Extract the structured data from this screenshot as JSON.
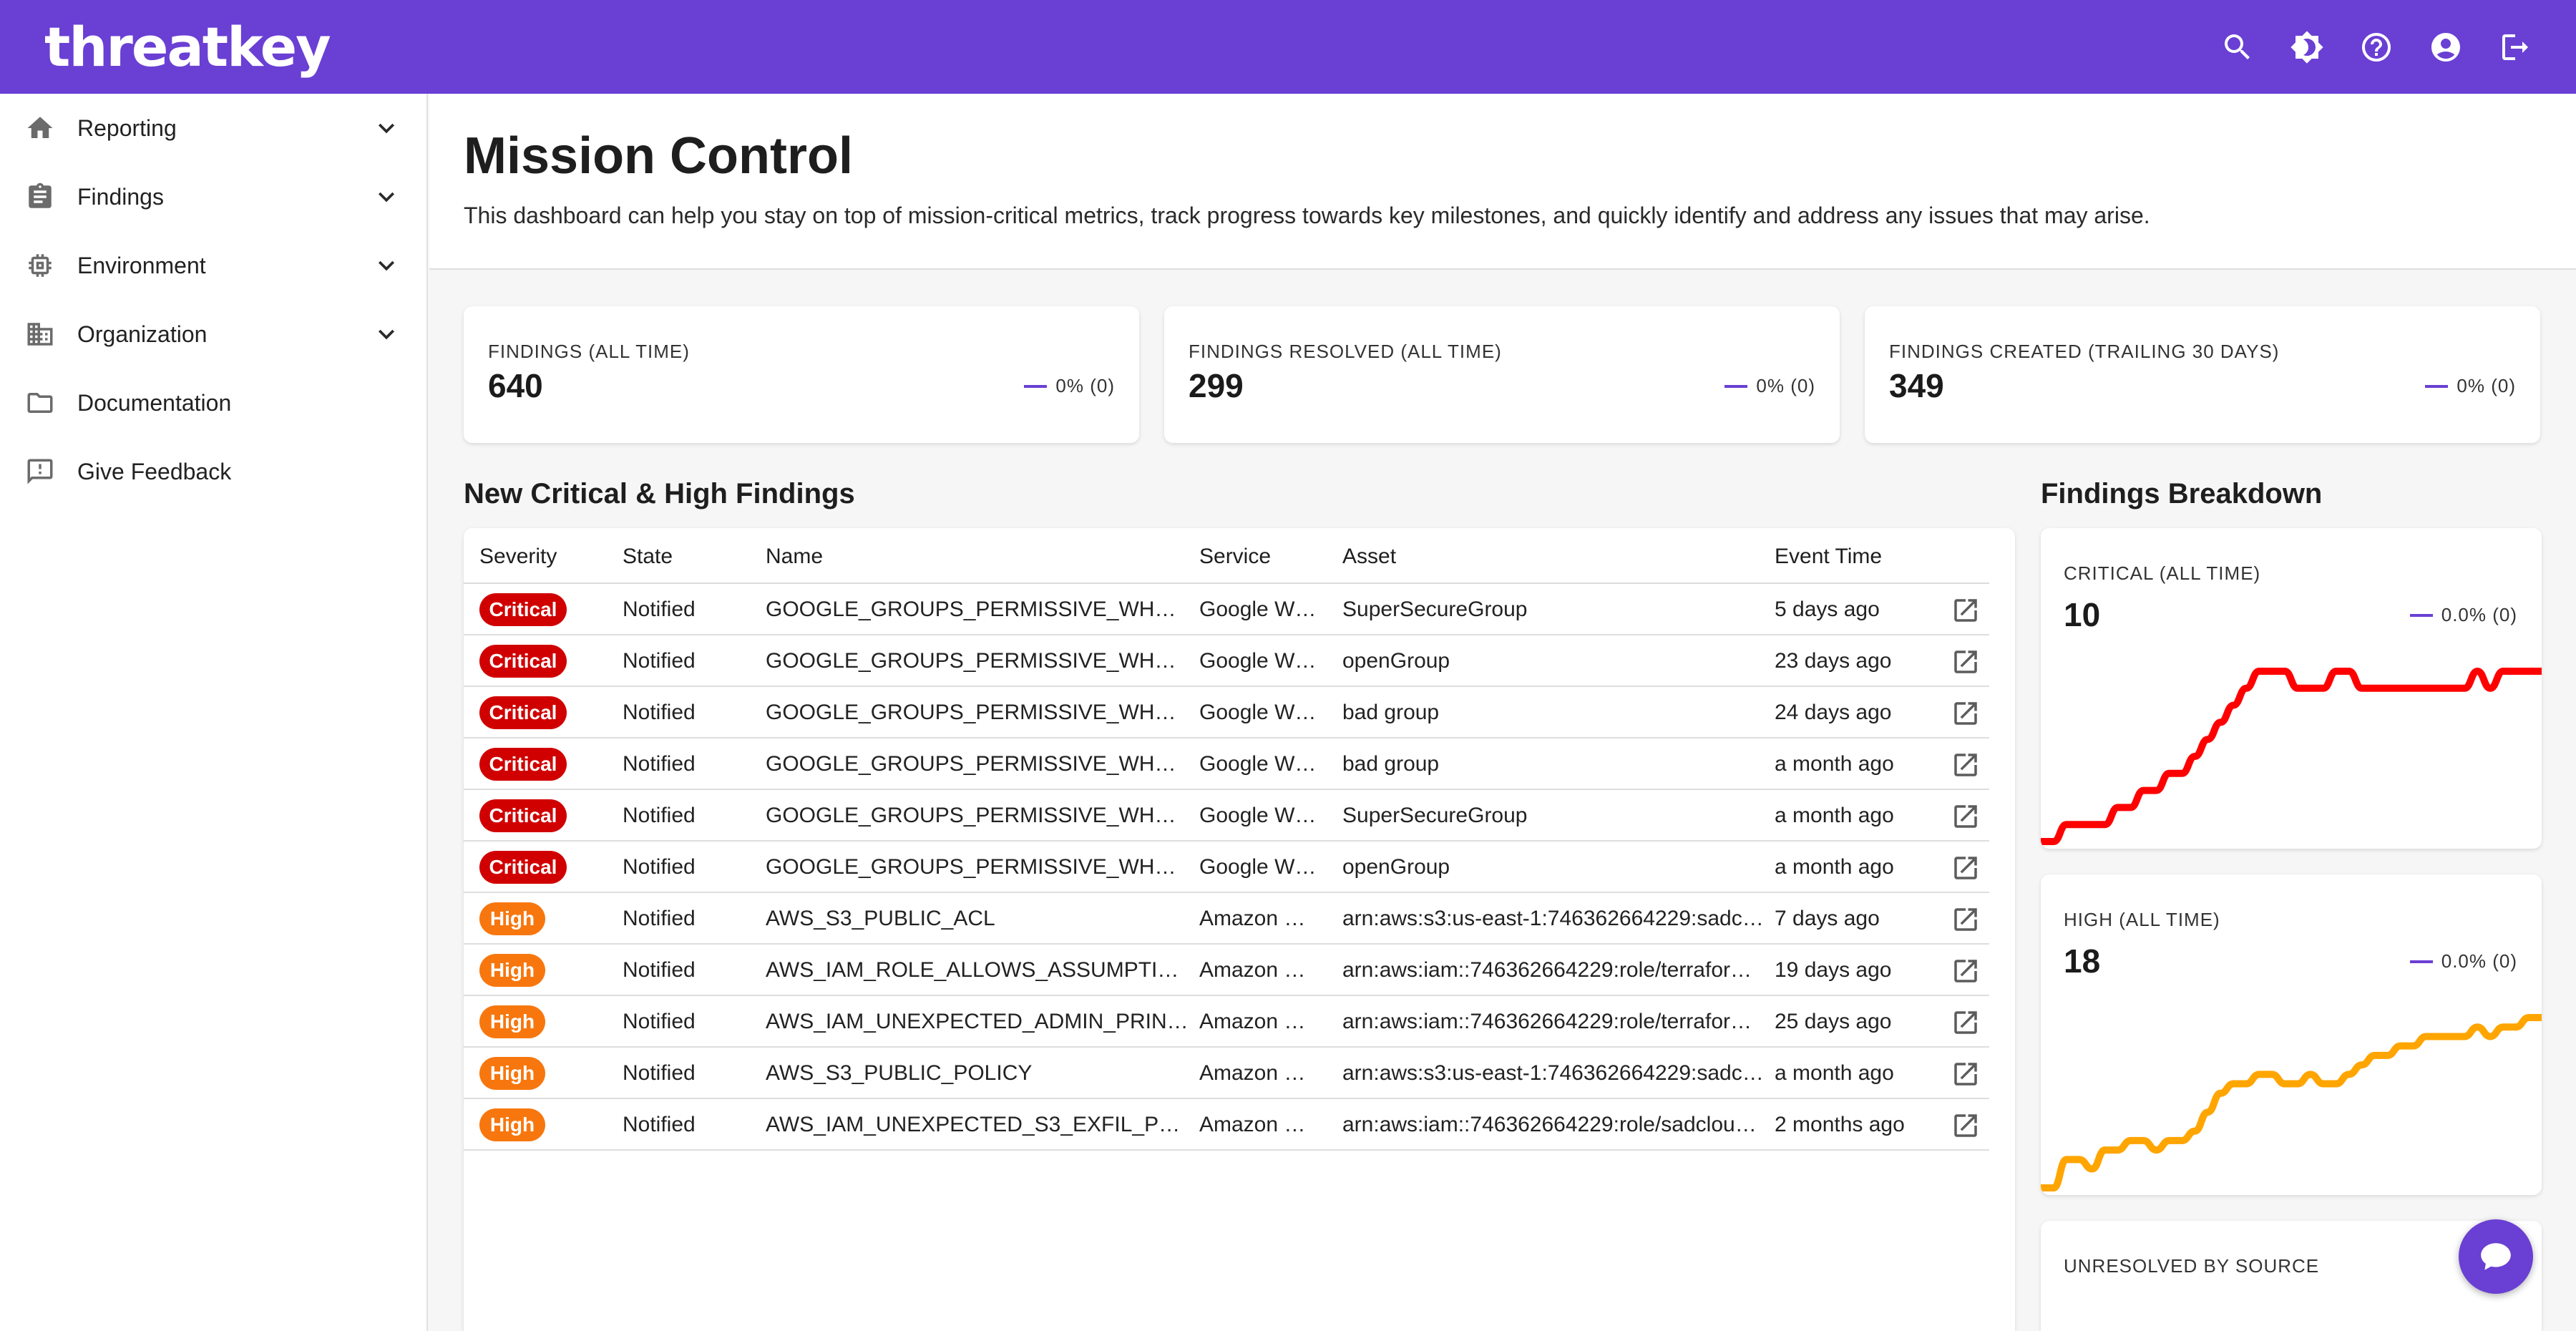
{
  "brand": {
    "logo_text": "threatkey",
    "accent": "#6a3fd4"
  },
  "topbar": {
    "icons": [
      "search-icon",
      "theme-toggle-icon",
      "help-icon",
      "account-icon",
      "logout-icon"
    ]
  },
  "sidebar": {
    "items": [
      {
        "label": "Reporting",
        "icon": "home-icon",
        "expandable": true
      },
      {
        "label": "Findings",
        "icon": "clipboard-icon",
        "expandable": true
      },
      {
        "label": "Environment",
        "icon": "chip-icon",
        "expandable": true
      },
      {
        "label": "Organization",
        "icon": "building-icon",
        "expandable": true
      },
      {
        "label": "Documentation",
        "icon": "folder-icon",
        "expandable": false
      },
      {
        "label": "Give Feedback",
        "icon": "feedback-icon",
        "expandable": false
      }
    ]
  },
  "header": {
    "title": "Mission Control",
    "description": "This dashboard can help you stay on top of mission-critical metrics, track progress towards key milestones, and quickly identify and address any issues that may arise."
  },
  "stats": [
    {
      "label": "FINDINGS (ALL TIME)",
      "value": "640",
      "trend": "0% (0)"
    },
    {
      "label": "FINDINGS RESOLVED (ALL TIME)",
      "value": "299",
      "trend": "0% (0)"
    },
    {
      "label": "FINDINGS CREATED (TRAILING 30 DAYS)",
      "value": "349",
      "trend": "0% (0)"
    }
  ],
  "findings": {
    "title": "New Critical & High Findings",
    "columns": [
      "Severity",
      "State",
      "Name",
      "Service",
      "Asset",
      "Event Time"
    ],
    "rows": [
      {
        "severity": "Critical",
        "state": "Notified",
        "name": "GOOGLE_GROUPS_PERMISSIVE_WH…",
        "service": "Google W…",
        "asset": "SuperSecureGroup",
        "time": "5 days ago"
      },
      {
        "severity": "Critical",
        "state": "Notified",
        "name": "GOOGLE_GROUPS_PERMISSIVE_WH…",
        "service": "Google W…",
        "asset": "openGroup",
        "time": "23 days ago"
      },
      {
        "severity": "Critical",
        "state": "Notified",
        "name": "GOOGLE_GROUPS_PERMISSIVE_WH…",
        "service": "Google W…",
        "asset": "bad group",
        "time": "24 days ago"
      },
      {
        "severity": "Critical",
        "state": "Notified",
        "name": "GOOGLE_GROUPS_PERMISSIVE_WH…",
        "service": "Google W…",
        "asset": "bad group",
        "time": "a month ago"
      },
      {
        "severity": "Critical",
        "state": "Notified",
        "name": "GOOGLE_GROUPS_PERMISSIVE_WH…",
        "service": "Google W…",
        "asset": "SuperSecureGroup",
        "time": "a month ago"
      },
      {
        "severity": "Critical",
        "state": "Notified",
        "name": "GOOGLE_GROUPS_PERMISSIVE_WH…",
        "service": "Google W…",
        "asset": "openGroup",
        "time": "a month ago"
      },
      {
        "severity": "High",
        "state": "Notified",
        "name": "AWS_S3_PUBLIC_ACL",
        "service": "Amazon …",
        "asset": "arn:aws:s3:us-east-1:746362664229:sadc…",
        "time": "7 days ago"
      },
      {
        "severity": "High",
        "state": "Notified",
        "name": "AWS_IAM_ROLE_ALLOWS_ASSUMPTI…",
        "service": "Amazon …",
        "asset": "arn:aws:iam::746362664229:role/terrafor…",
        "time": "19 days ago"
      },
      {
        "severity": "High",
        "state": "Notified",
        "name": "AWS_IAM_UNEXPECTED_ADMIN_PRIN…",
        "service": "Amazon …",
        "asset": "arn:aws:iam::746362664229:role/terrafor…",
        "time": "25 days ago"
      },
      {
        "severity": "High",
        "state": "Notified",
        "name": "AWS_S3_PUBLIC_POLICY",
        "service": "Amazon …",
        "asset": "arn:aws:s3:us-east-1:746362664229:sadc…",
        "time": "a month ago"
      },
      {
        "severity": "High",
        "state": "Notified",
        "name": "AWS_IAM_UNEXPECTED_S3_EXFIL_P…",
        "service": "Amazon …",
        "asset": "arn:aws:iam::746362664229:role/sadclou…",
        "time": "2 months ago"
      }
    ],
    "colors": {
      "Critical": "#d10000",
      "High": "#f7770e"
    }
  },
  "breakdown": {
    "title": "Findings Breakdown",
    "cards": [
      {
        "label": "CRITICAL (ALL TIME)",
        "value": "10",
        "trend": "0.0% (0)",
        "color": "#ff0000",
        "series": [
          0,
          0,
          1,
          1,
          1,
          1,
          2,
          2,
          3,
          3,
          4,
          4,
          5,
          6,
          7,
          8,
          9,
          10,
          10,
          10,
          9,
          9,
          9,
          10,
          10,
          9,
          9,
          9,
          9,
          9,
          9,
          9,
          9,
          9,
          10,
          9,
          10,
          10,
          10,
          10
        ]
      },
      {
        "label": "HIGH (ALL TIME)",
        "value": "18",
        "trend": "0.0% (0)",
        "color": "#ffa500",
        "series": [
          0,
          0,
          3,
          3,
          2,
          4,
          4,
          5,
          5,
          4,
          5,
          5,
          6,
          8,
          10,
          11,
          11,
          12,
          12,
          11,
          11,
          12,
          11,
          11,
          12,
          13,
          14,
          14,
          15,
          15,
          16,
          16,
          16,
          16,
          17,
          16,
          17,
          17,
          18,
          18
        ]
      },
      {
        "label": "UNRESOLVED BY SOURCE",
        "value": "",
        "trend": "",
        "color": "#6a3fd4",
        "series": []
      }
    ]
  }
}
